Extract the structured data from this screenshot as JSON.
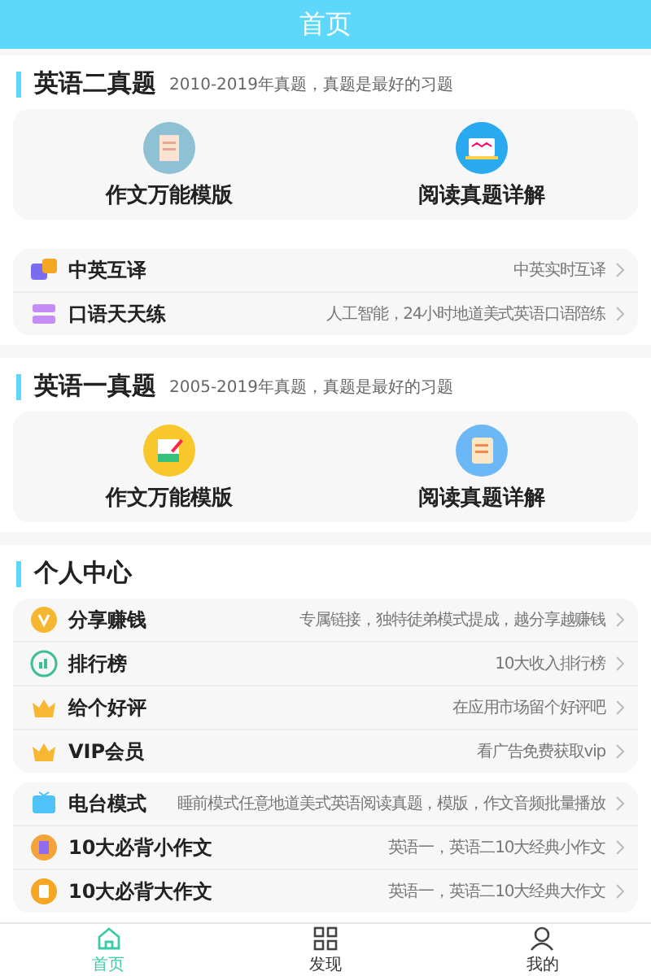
{
  "header": {
    "title": "首页"
  },
  "sections": [
    {
      "title": "英语二真题",
      "subtitle": "2010-2019年真题，真题是最好的习题",
      "tiles": [
        "作文万能模版",
        "阅读真题详解"
      ],
      "after": [
        {
          "label": "中英互译",
          "hint": "中英实时互译"
        },
        {
          "label": "口语天天练",
          "hint": "人工智能，24小时地道美式英语口语陪练"
        }
      ]
    },
    {
      "title": "英语一真题",
      "subtitle": "2005-2019年真题，真题是最好的习题",
      "tiles": [
        "作文万能模版",
        "阅读真题详解"
      ]
    }
  ],
  "personal": {
    "title": "个人中心",
    "groups": [
      [
        {
          "label": "分享赚钱",
          "hint": "专属链接，独特徒弟模式提成，越分享越赚钱"
        },
        {
          "label": "排行榜",
          "hint": "10大收入排行榜"
        },
        {
          "label": "给个好评",
          "hint": "在应用市场留个好评吧"
        },
        {
          "label": "VIP会员",
          "hint": "看广告免费获取vip"
        }
      ],
      [
        {
          "label": "电台模式",
          "hint": "睡前模式任意地道美式英语阅读真题，模版，作文音频批量播放"
        },
        {
          "label": "10大必背小作文",
          "hint": "英语一，英语二10大经典小作文"
        },
        {
          "label": "10大必背大作文",
          "hint": "英语一，英语二10大经典大作文"
        }
      ]
    ]
  },
  "tabbar": [
    {
      "label": "首页",
      "selected": true
    },
    {
      "label": "发现",
      "selected": false
    },
    {
      "label": "我的",
      "selected": false
    }
  ]
}
